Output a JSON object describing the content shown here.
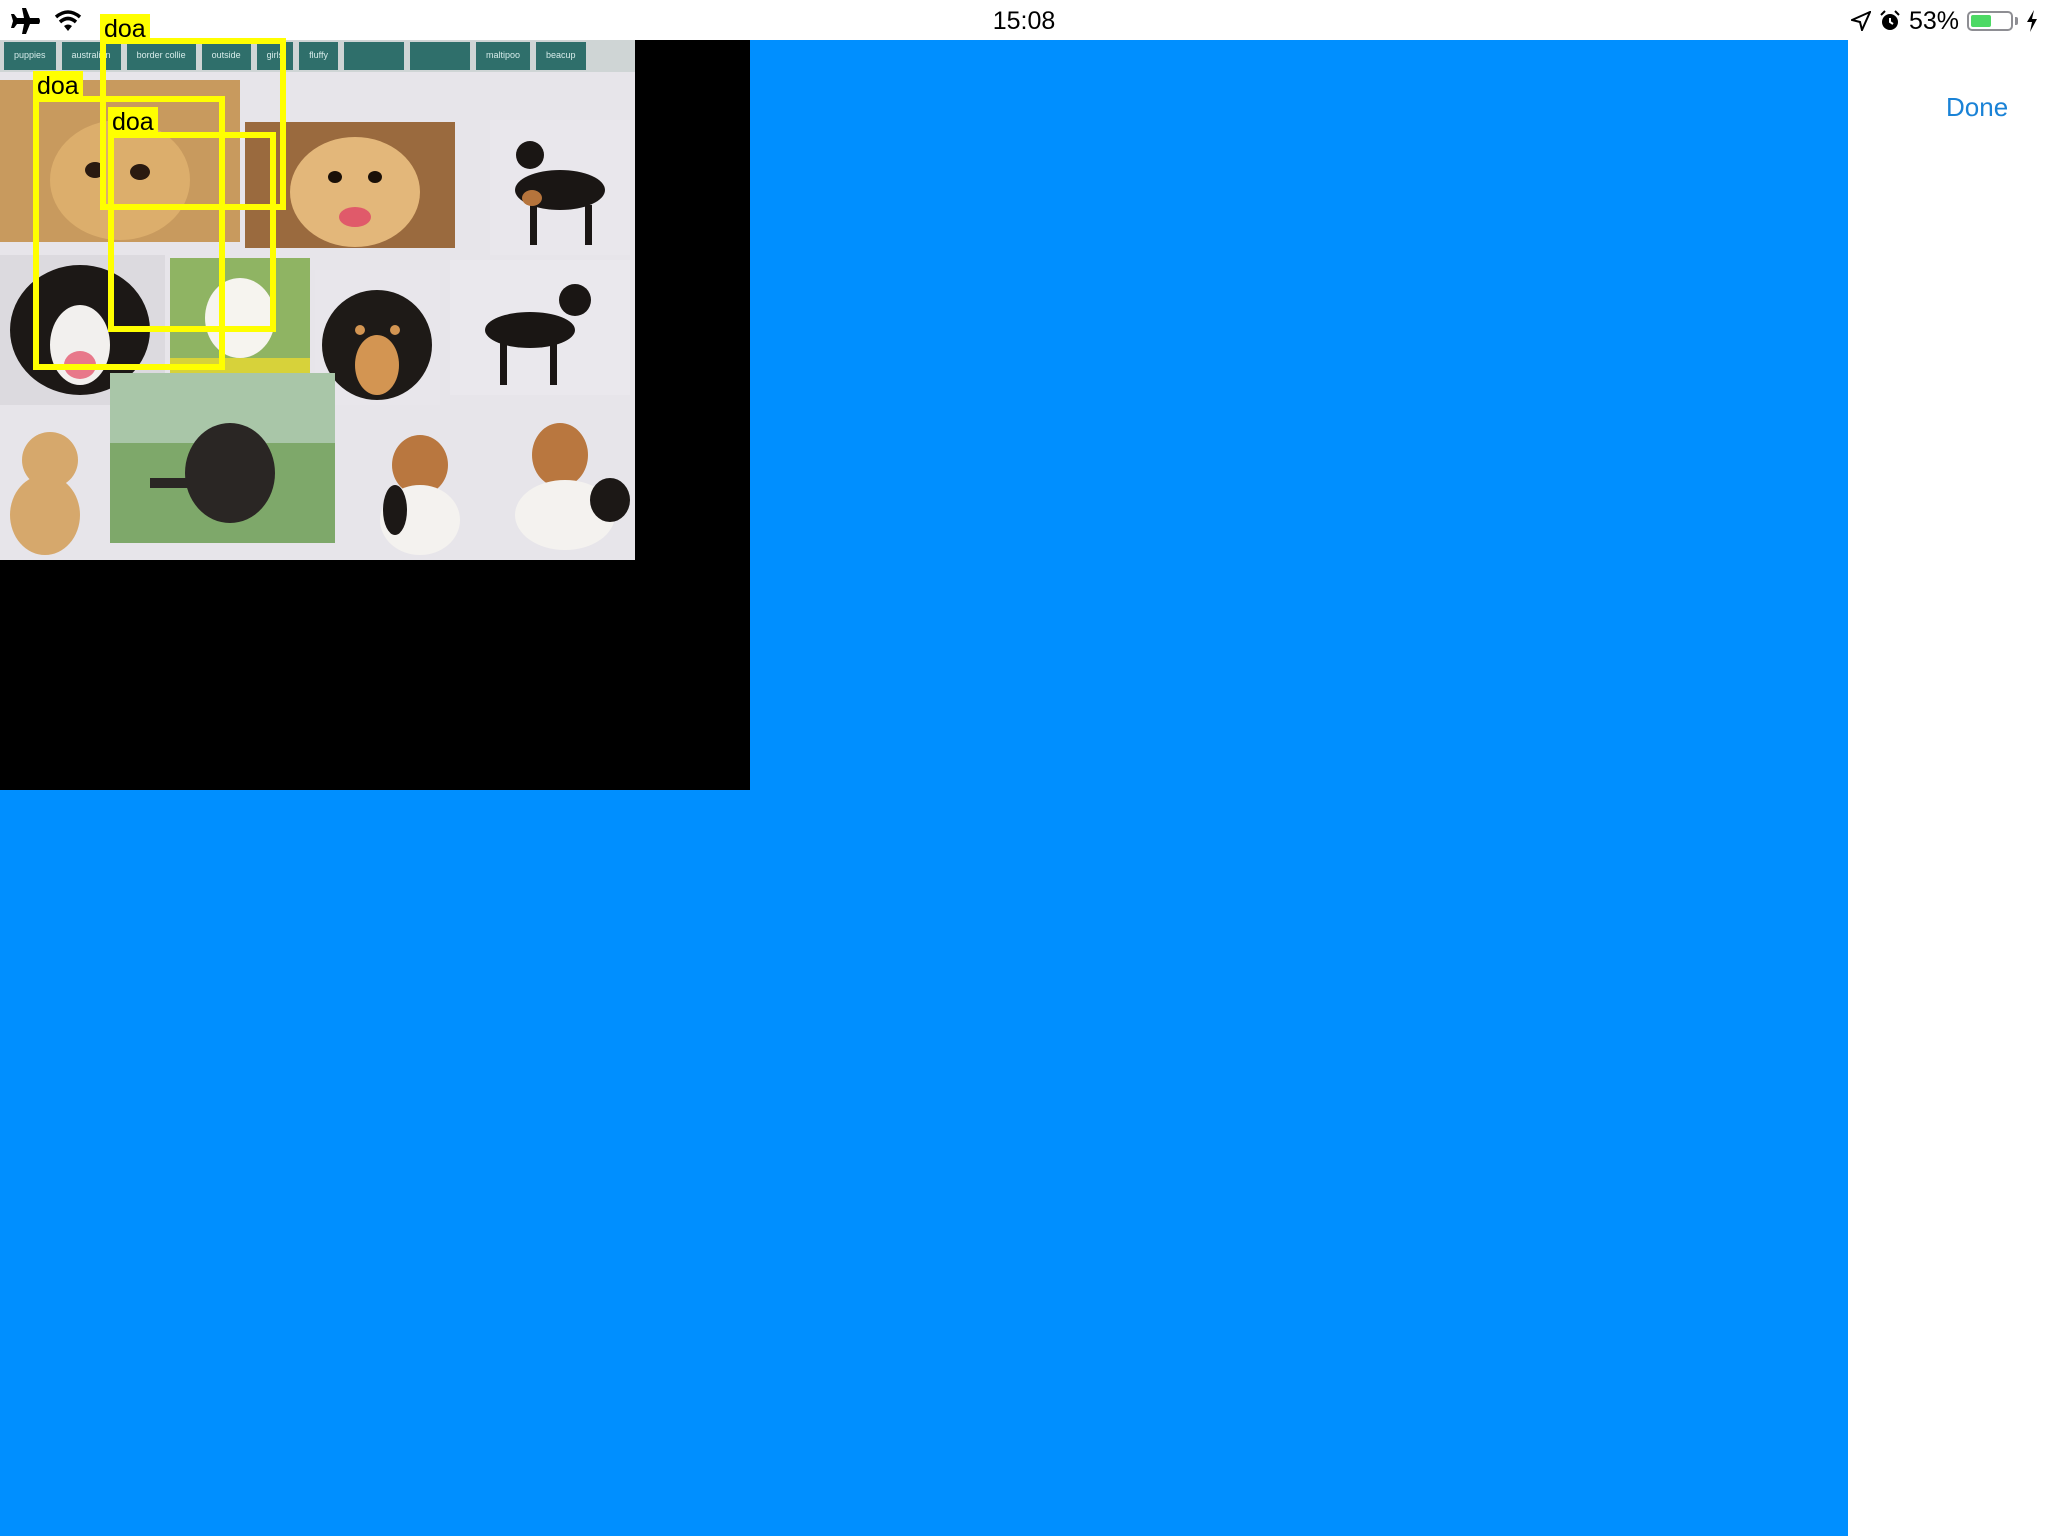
{
  "status_bar": {
    "time": "15:08",
    "battery_percent": "53%",
    "battery_level": 0.53,
    "icons": [
      "airplane-icon",
      "wifi-icon",
      "location-icon",
      "alarm-icon",
      "battery-icon",
      "charging-icon"
    ]
  },
  "nav": {
    "done_label": "Done"
  },
  "preview": {
    "tags": [
      "puppies",
      "australian",
      "border collie",
      "outside",
      "girls",
      "fluffy",
      "",
      "",
      "maltipoo",
      "beacup"
    ]
  },
  "detections": [
    {
      "label": "doa"
    },
    {
      "label": "doa"
    },
    {
      "label": "doa"
    }
  ],
  "colors": {
    "background": "#008fff",
    "detection": "#ffff00",
    "done_button": "#1a82d6",
    "battery_fill": "#4cd964"
  }
}
